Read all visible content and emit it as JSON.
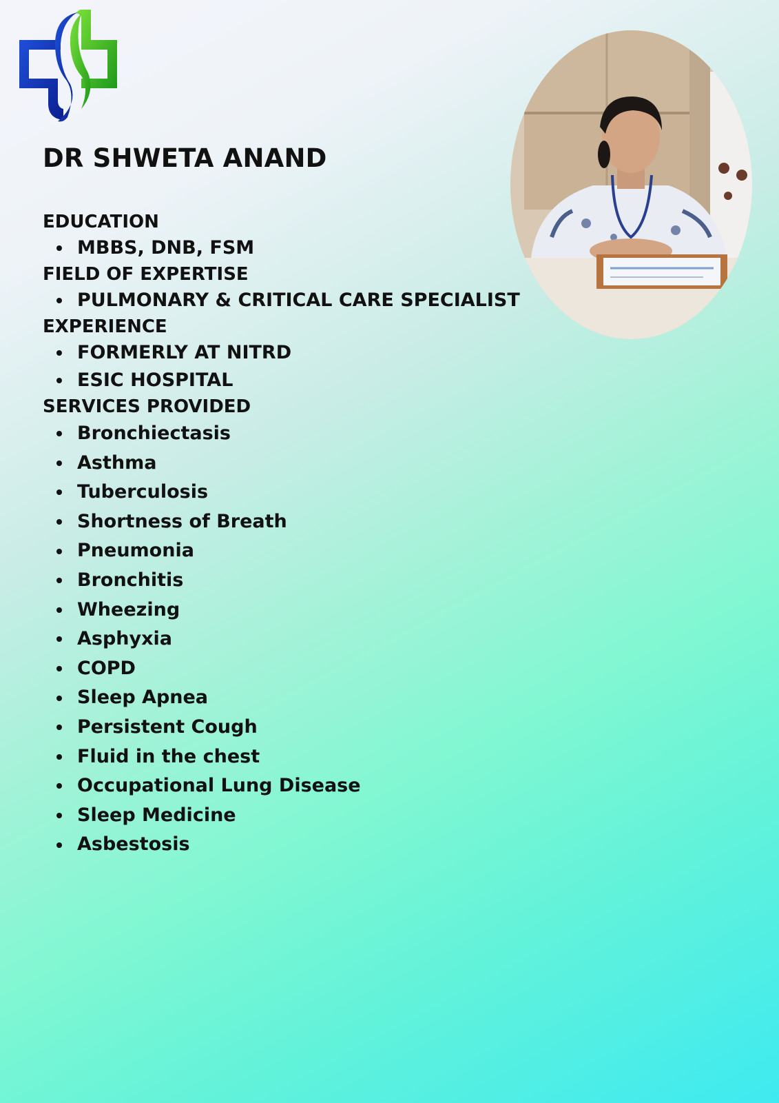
{
  "doctor": {
    "name": "DR SHWETA ANAND"
  },
  "sections": {
    "education": {
      "heading": "EDUCATION",
      "items": [
        "MBBS, DNB, FSM"
      ]
    },
    "field": {
      "heading": "FIELD OF EXPERTISE",
      "items": [
        "PULMONARY & CRITICAL CARE SPECIALIST"
      ]
    },
    "experience": {
      "heading": "EXPERIENCE",
      "items": [
        "FORMERLY AT NITRD",
        "ESIC HOSPITAL"
      ]
    },
    "services": {
      "heading": "SERVICES PROVIDED",
      "items": [
        "Bronchiectasis",
        "Asthma",
        "Tuberculosis",
        "Shortness of Breath",
        "Pneumonia",
        "Bronchitis",
        "Wheezing",
        "Asphyxia",
        "COPD",
        "Sleep Apnea",
        "Persistent Cough",
        "Fluid in the chest",
        "Occupational Lung Disease",
        "Sleep Medicine",
        "Asbestosis"
      ]
    }
  },
  "colors": {
    "logo_blue": "#1238b8",
    "logo_green": "#3cc21c",
    "text": "#111111"
  },
  "icons": {
    "logo": "medical-cross-logo-icon",
    "photo": "doctor-portrait"
  }
}
